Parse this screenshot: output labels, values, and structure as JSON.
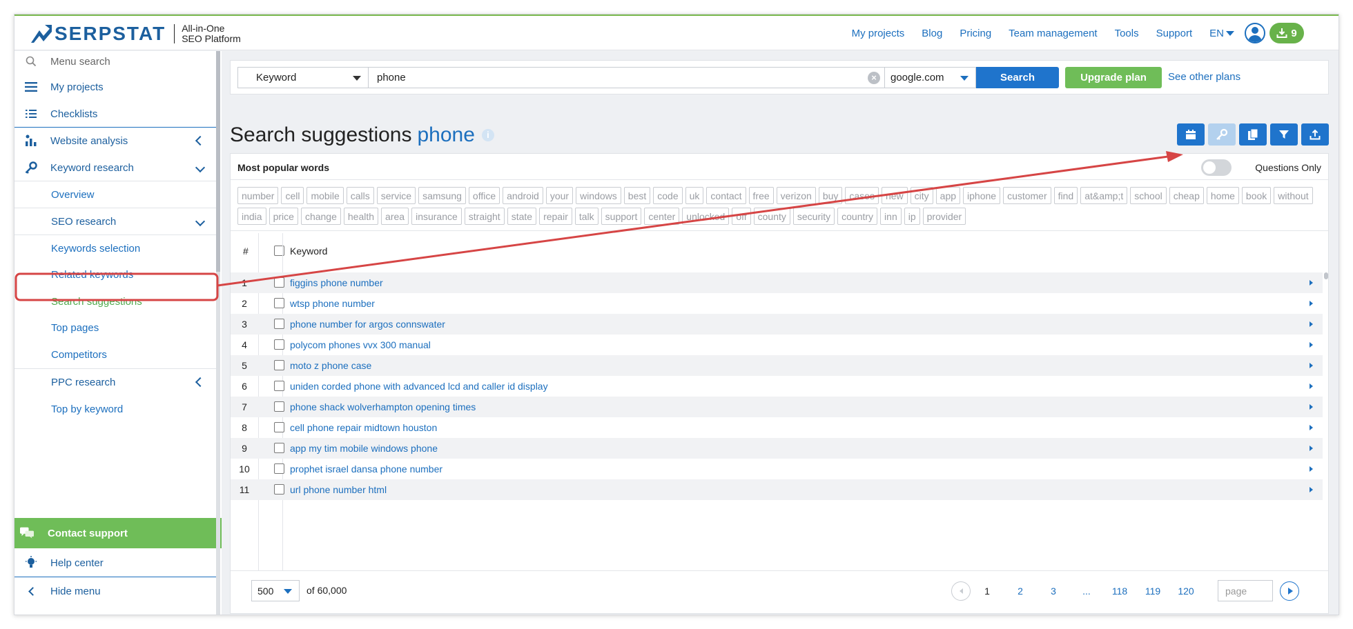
{
  "header": {
    "logo_text": "SERPSTAT",
    "tagline_line1": "All-in-One",
    "tagline_line2": "SEO Platform",
    "nav": [
      "My projects",
      "Blog",
      "Pricing",
      "Team management",
      "Tools",
      "Support"
    ],
    "language": "EN",
    "downloads_count": "9"
  },
  "sidebar": {
    "search_placeholder": "Menu search",
    "my_projects": "My projects",
    "checklists": "Checklists",
    "website_analysis": "Website analysis",
    "keyword_research": "Keyword research",
    "overview": "Overview",
    "seo_research": "SEO research",
    "keywords_selection": "Keywords selection",
    "related_keywords": "Related keywords",
    "search_suggestions": "Search suggestions",
    "top_pages": "Top pages",
    "competitors": "Competitors",
    "ppc_research": "PPC research",
    "top_by_keyword": "Top by keyword",
    "contact_support": "Contact support",
    "help_center": "Help center",
    "hide_menu": "Hide menu"
  },
  "search": {
    "type": "Keyword",
    "query": "phone",
    "database": "google.com",
    "search_label": "Search",
    "upgrade_label": "Upgrade plan",
    "other_plans": "See other plans"
  },
  "page": {
    "title": "Search suggestions",
    "keyword": "phone"
  },
  "panel": {
    "popular_label": "Most popular words",
    "questions_only": "Questions Only",
    "tags": [
      "number",
      "cell",
      "mobile",
      "calls",
      "service",
      "samsung",
      "office",
      "android",
      "your",
      "windows",
      "best",
      "code",
      "uk",
      "contact",
      "free",
      "verizon",
      "buy",
      "cases",
      "new",
      "city",
      "app",
      "iphone",
      "customer",
      "find",
      "at&amp;t",
      "school",
      "cheap",
      "home",
      "book",
      "without",
      "india",
      "price",
      "change",
      "health",
      "area",
      "insurance",
      "straight",
      "state",
      "repair",
      "talk",
      "support",
      "center",
      "unlocked",
      "off",
      "county",
      "security",
      "country",
      "inn",
      "ip",
      "provider"
    ]
  },
  "table": {
    "col_num": "#",
    "col_keyword": "Keyword",
    "rows": [
      {
        "n": "1",
        "kw": "figgins phone number"
      },
      {
        "n": "2",
        "kw": "wtsp phone number"
      },
      {
        "n": "3",
        "kw": "phone number for argos connswater"
      },
      {
        "n": "4",
        "kw": "polycom phones vvx 300 manual"
      },
      {
        "n": "5",
        "kw": "moto z phone case"
      },
      {
        "n": "6",
        "kw": "uniden corded phone with advanced lcd and caller id display"
      },
      {
        "n": "7",
        "kw": "phone shack wolverhampton opening times"
      },
      {
        "n": "8",
        "kw": "cell phone repair midtown houston"
      },
      {
        "n": "9",
        "kw": "app my tim mobile windows phone"
      },
      {
        "n": "10",
        "kw": "prophet israel dansa phone number"
      },
      {
        "n": "11",
        "kw": "url phone number html"
      }
    ]
  },
  "footer": {
    "per_page": "500",
    "of_total": "of 60,000",
    "pages": [
      "1",
      "2",
      "3",
      "...",
      "118",
      "119",
      "120"
    ],
    "current_page": "1",
    "page_placeholder": "page"
  },
  "colors": {
    "brand_blue": "#1c5f9e",
    "link_blue": "#1c6fbe",
    "button_blue": "#1f74cc",
    "green": "#6fbd58",
    "annotation_red": "#d64545"
  }
}
